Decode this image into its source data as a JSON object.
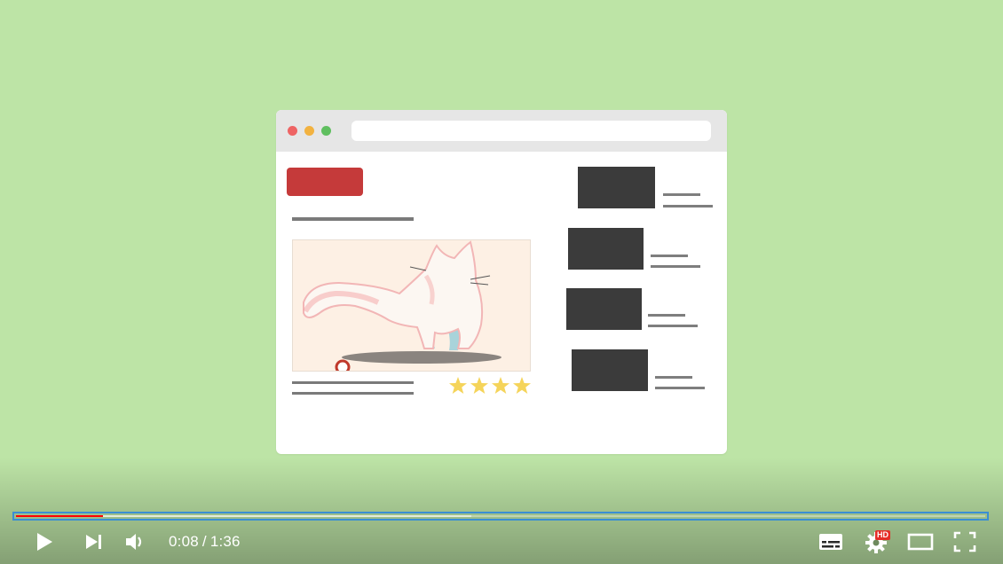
{
  "player": {
    "current_time": "0:08",
    "separator": "/",
    "duration": "1:36",
    "played_fraction": 0.09,
    "buffered_fraction": 0.47,
    "hd_badge": "HD",
    "progress_color": "#ff0000",
    "focus_outline_color": "#3a8ed3",
    "controls": {
      "left": [
        "play-icon",
        "next-icon",
        "volume-icon"
      ],
      "right": [
        "subtitles-icon",
        "settings-icon",
        "theater-mode-icon",
        "fullscreen-icon"
      ]
    }
  },
  "scene": {
    "background_color": "#bde4a6",
    "mock_browser": {
      "traffic_light_colors": [
        "#ee6464",
        "#f2b240",
        "#5fbf5f"
      ],
      "button_color": "#c53a3a",
      "image": "cat-illustration",
      "star_rating": 4,
      "sidebar_item_count": 4
    }
  }
}
